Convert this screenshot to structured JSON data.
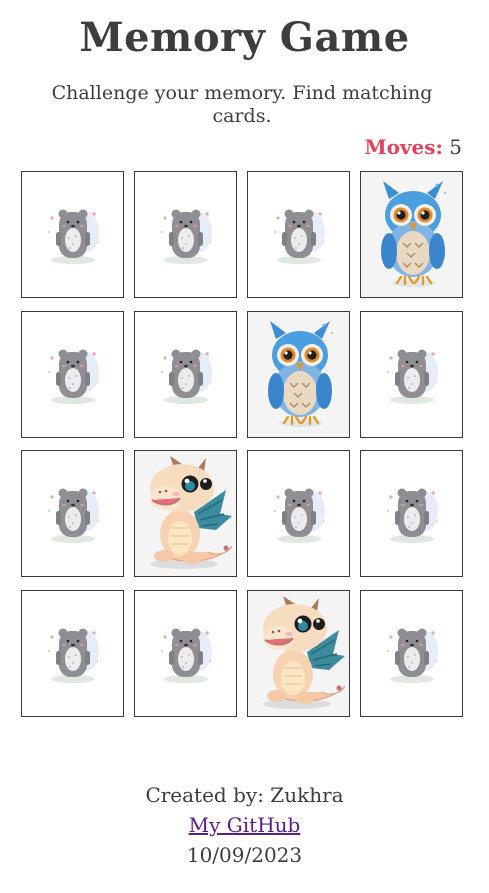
{
  "header": {
    "title": "Memory Game",
    "subtitle": "Challenge your memory. Find matching cards."
  },
  "moves": {
    "label": "Moves:",
    "value": "5"
  },
  "board": {
    "columns": 4,
    "rows": 4,
    "cards": [
      {
        "state": "hidden",
        "icon": "bear-icon"
      },
      {
        "state": "hidden",
        "icon": "bear-icon"
      },
      {
        "state": "hidden",
        "icon": "bear-icon"
      },
      {
        "state": "revealed",
        "icon": "owl-icon"
      },
      {
        "state": "hidden",
        "icon": "bear-icon"
      },
      {
        "state": "hidden",
        "icon": "bear-icon"
      },
      {
        "state": "revealed",
        "icon": "owl-icon"
      },
      {
        "state": "hidden",
        "icon": "bear-icon"
      },
      {
        "state": "hidden",
        "icon": "bear-icon"
      },
      {
        "state": "revealed",
        "icon": "dragon-icon"
      },
      {
        "state": "hidden",
        "icon": "bear-icon"
      },
      {
        "state": "hidden",
        "icon": "bear-icon"
      },
      {
        "state": "hidden",
        "icon": "bear-icon"
      },
      {
        "state": "hidden",
        "icon": "bear-icon"
      },
      {
        "state": "revealed",
        "icon": "dragon-icon"
      },
      {
        "state": "hidden",
        "icon": "bear-icon"
      }
    ]
  },
  "footer": {
    "created_by": "Created by: Zukhra",
    "link_label": "My GitHub",
    "date": "10/09/2023"
  },
  "colors": {
    "moves_label": "#e2435a",
    "link": "#5a1f8a",
    "text": "#3d3d3d"
  }
}
